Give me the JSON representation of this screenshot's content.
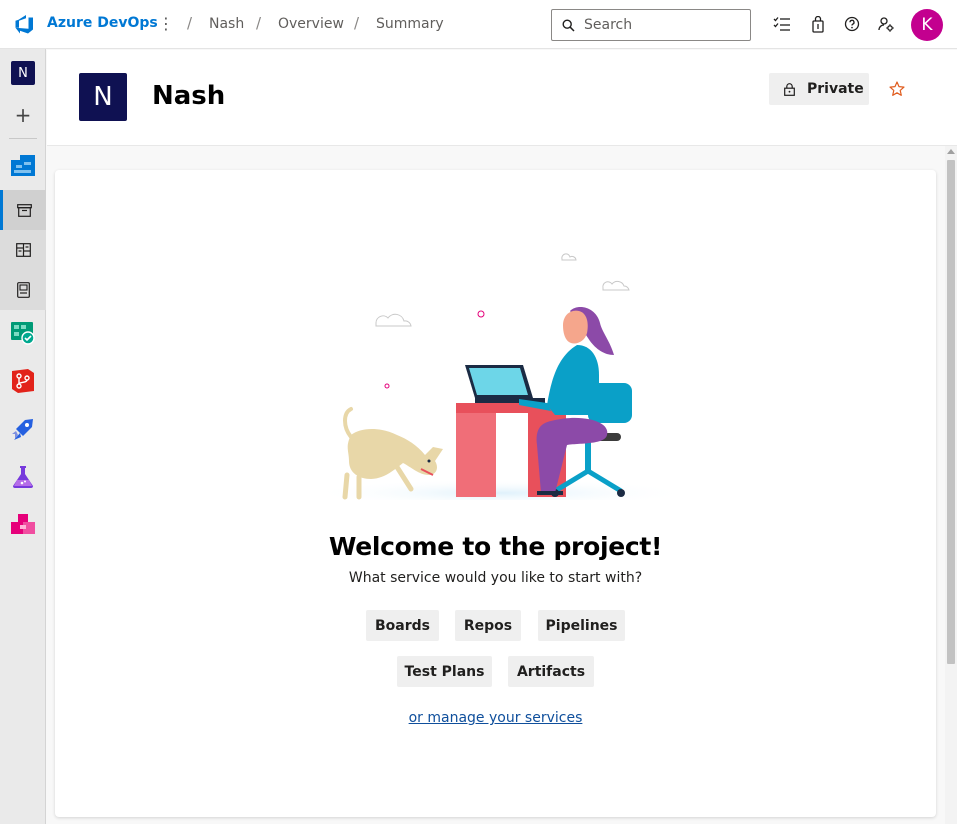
{
  "brand": {
    "name": "Azure DevOps",
    "accent": "#0078d4"
  },
  "breadcrumb": {
    "items": [
      "Nash",
      "Overview",
      "Summary"
    ]
  },
  "search": {
    "placeholder": "Search"
  },
  "user": {
    "initial": "K",
    "color": "#c3008f"
  },
  "rail": {
    "project_initial": "N",
    "add_label": "+"
  },
  "project": {
    "initial": "N",
    "name": "Nash",
    "visibility": "Private"
  },
  "welcome": {
    "title": "Welcome to the project!",
    "subtitle": "What service would you like to start with?",
    "services_row1": [
      "Boards",
      "Repos",
      "Pipelines"
    ],
    "services_row2": [
      "Test Plans",
      "Artifacts"
    ],
    "manage_link": "or manage your services"
  },
  "icons": [
    "azure-devops-logo-icon",
    "more-options-icon",
    "search-icon",
    "task-list-icon",
    "shopping-bag-icon",
    "help-icon",
    "user-settings-icon",
    "lock-icon",
    "star-icon",
    "overview-icon",
    "summary-icon",
    "dashboards-icon",
    "wiki-icon",
    "boards-icon",
    "repos-icon",
    "pipelines-icon",
    "test-plans-icon",
    "artifacts-icon"
  ]
}
